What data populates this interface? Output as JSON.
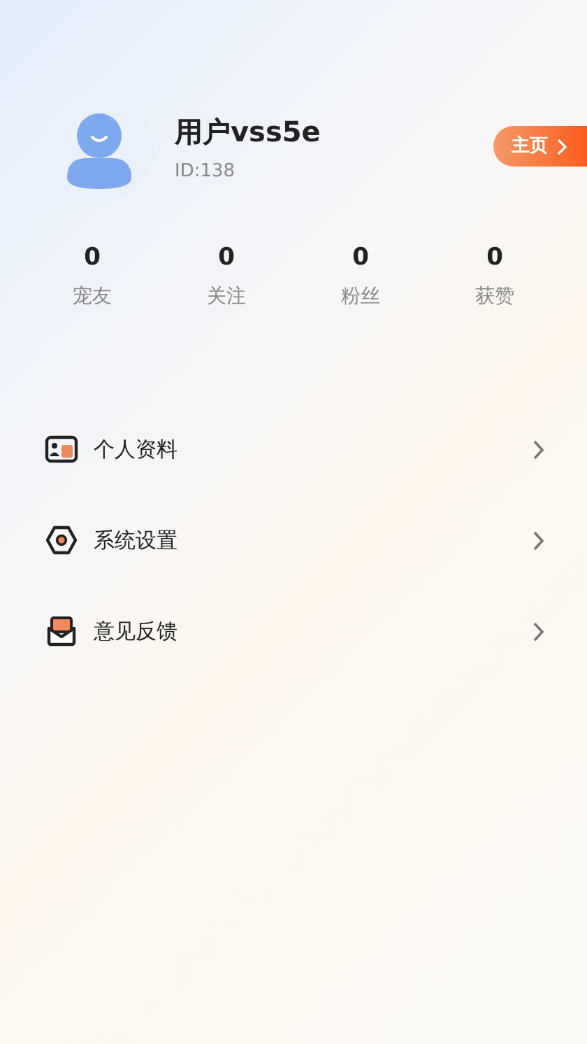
{
  "profile": {
    "name": "用户vss5e",
    "id": "ID:138",
    "home_button": "主页"
  },
  "stats": [
    {
      "value": "0",
      "label": "宠友"
    },
    {
      "value": "0",
      "label": "关注"
    },
    {
      "value": "0",
      "label": "粉丝"
    },
    {
      "value": "0",
      "label": "获赞"
    }
  ],
  "menu": [
    {
      "kind": "profile",
      "label": "个人资料"
    },
    {
      "kind": "settings",
      "label": "系统设置"
    },
    {
      "kind": "feedback",
      "label": "意见反馈"
    }
  ]
}
